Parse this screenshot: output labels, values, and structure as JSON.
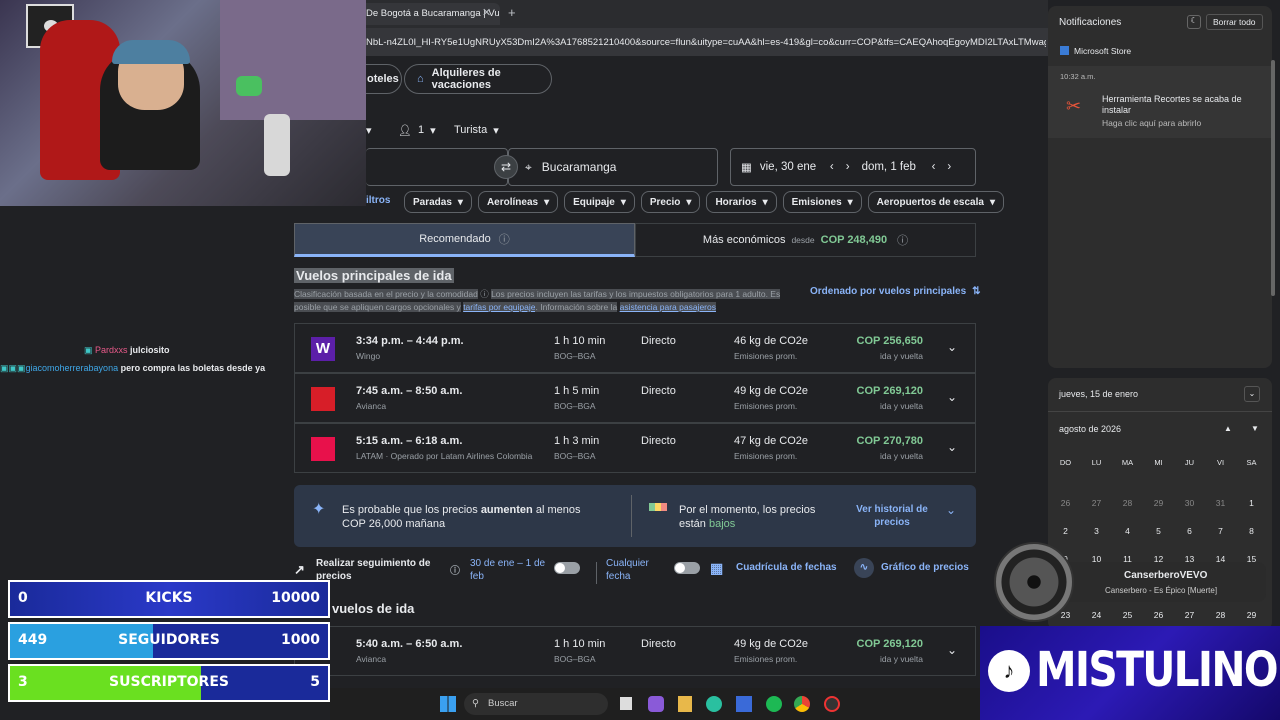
{
  "browser": {
    "tab_title": "De Bogotá a Bucaramanga | Vu",
    "url": "NbL-n4ZL0I_HI-RY5e1UgNRUyX53DmI2A%3A1768521210400&source=flun&uitype=cuAA&hl=es-419&gl=co&curr=COP&tfs=CAEQAhoqEgoyMDI2LTAxLTMwag0IAh"
  },
  "nav": {
    "hotels": "oteles",
    "rentals": "Alquileres de vacaciones"
  },
  "search": {
    "passengers": "1",
    "cabin": "Turista",
    "destination": "Bucaramanga",
    "depart": "vie, 30 ene",
    "return": "dom, 1 feb"
  },
  "filters": {
    "all": "iltros",
    "chips": [
      "Paradas",
      "Aerolíneas",
      "Equipaje",
      "Precio",
      "Horarios",
      "Emisiones",
      "Aeropuertos de escala"
    ]
  },
  "sort_tabs": {
    "recommended": "Recomendado",
    "cheapest": "Más económicos",
    "from": "desde",
    "cheapest_price": "COP 248,490"
  },
  "section": {
    "title": "Vuelos principales de ida",
    "note1": "Clasificación basada en el precio y la comodidad",
    "note2": "Los precios incluyen las tarifas y los impuestos obligatorios para 1 adulto. Es",
    "note3": "posible que se apliquen cargos opcionales y",
    "link1": "tarifas por equipaje",
    "note4": ". Información sobre la",
    "link2": "asistencia para pasajeros",
    "sort": "Ordenado por vuelos principales"
  },
  "flights": [
    {
      "times": "3:34 p.m. – 4:44 p.m.",
      "airline": "Wingo",
      "duration": "1 h 10 min",
      "route": "BOG–BGA",
      "stops": "Directo",
      "co2": "46 kg de CO2e",
      "co2_sub": "Emisiones prom.",
      "price": "COP 256,650",
      "price_sub": "ida y vuelta",
      "logo_color": "#5c1fa8",
      "logo": "W"
    },
    {
      "times": "7:45 a.m. – 8:50 a.m.",
      "airline": "Avianca",
      "duration": "1 h 5 min",
      "route": "BOG–BGA",
      "stops": "Directo",
      "co2": "49 kg de CO2e",
      "co2_sub": "Emisiones prom.",
      "price": "COP 269,120",
      "price_sub": "ida y vuelta",
      "logo_color": "#d71e28",
      "logo": ""
    },
    {
      "times": "5:15 a.m. – 6:18 a.m.",
      "airline": "LATAM · Operado por Latam Airlines Colombia",
      "duration": "1 h 3 min",
      "route": "BOG–BGA",
      "stops": "Directo",
      "co2": "47 kg de CO2e",
      "co2_sub": "Emisiones prom.",
      "price": "COP 270,780",
      "price_sub": "ida y vuelta",
      "logo_color": "#e8114b",
      "logo": ""
    }
  ],
  "insight": {
    "line1a": "Es probable que los precios",
    "line1b": "aumenten",
    "line1c": "al menos",
    "line2": "COP 26,000 mañana",
    "now1": "Por el momento, los precios",
    "now2": "están",
    "now3": "bajos",
    "history": "Ver historial de precios"
  },
  "tracking": {
    "label": "Realizar seguimiento de precios",
    "dates": "30 de ene – 1 de feb",
    "any": "Cualquier fecha",
    "grid": "Cuadrícula de fechas",
    "graph": "Gráfico de precios"
  },
  "other": {
    "title": "vuelos de ida",
    "times": "5:40 a.m. – 6:50 a.m.",
    "airline": "Avianca",
    "duration": "1 h 10 min",
    "route": "BOG–BGA",
    "stops": "Directo",
    "co2": "49 kg de CO2e",
    "co2_sub": "Emisiones prom.",
    "price": "COP 269,120",
    "price_sub": "ida y vuelta"
  },
  "notifications": {
    "title": "Notificaciones",
    "clear": "Borrar todo",
    "app": "Microsoft Store",
    "time": "10:32 a.m.",
    "msg_title": "Herramienta Recortes se acaba de instalar",
    "msg_sub": "Haga clic aquí para abrirlo"
  },
  "calendar": {
    "today": "jueves, 15 de enero",
    "month": "agosto de 2026",
    "days": [
      "DO",
      "LU",
      "MA",
      "MI",
      "JU",
      "VI",
      "SA"
    ],
    "rows": [
      [
        "26",
        "27",
        "28",
        "29",
        "30",
        "31",
        "1"
      ],
      [
        "2",
        "3",
        "4",
        "5",
        "6",
        "7",
        "8"
      ],
      [
        "9",
        "10",
        "11",
        "12",
        "13",
        "14",
        "15"
      ],
      [
        "23",
        "24",
        "25",
        "26",
        "27",
        "28",
        "29"
      ]
    ]
  },
  "music": {
    "artist": "CanserberoVEVO",
    "track": "Canserbero - Es Épico [Muerte]"
  },
  "chat": [
    {
      "user": "Pardxxs",
      "msg": "julciosito"
    },
    {
      "user": "giacomoherrerabayona",
      "msg": "pero compra las boletas desde ya"
    }
  ],
  "stats": [
    {
      "cur": "0",
      "label": "KICKS",
      "goal": "10000"
    },
    {
      "cur": "449",
      "label": "SEGUIDORES",
      "goal": "1000"
    },
    {
      "cur": "3",
      "label": "SUSCRIPTORES",
      "goal": "5"
    }
  ],
  "taskbar": {
    "search": "Buscar"
  },
  "banner": {
    "name": "MISTULINO"
  }
}
